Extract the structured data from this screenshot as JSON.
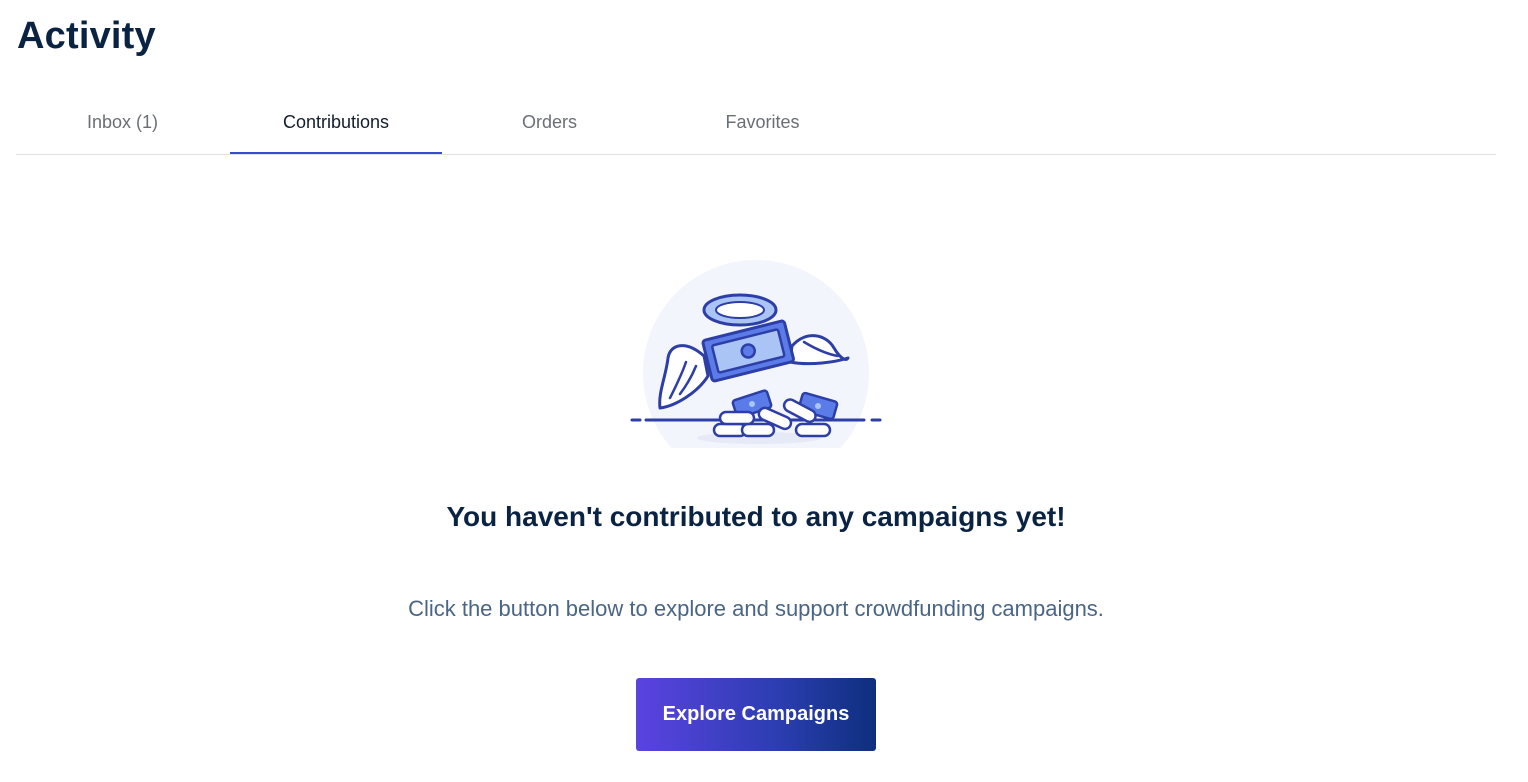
{
  "page": {
    "title": "Activity"
  },
  "tabs": [
    {
      "label": "Inbox (1)",
      "active": false
    },
    {
      "label": "Contributions",
      "active": true
    },
    {
      "label": "Orders",
      "active": false
    },
    {
      "label": "Favorites",
      "active": false
    }
  ],
  "empty_state": {
    "illustration": "angel-money-icon",
    "heading": "You haven't contributed to any campaigns yet!",
    "subtext": "Click the button below to explore and support crowdfunding campaigns.",
    "button_label": "Explore Campaigns"
  },
  "colors": {
    "title": "#0b2343",
    "active_tab_underline": "#3a4bd0",
    "illustration_stroke": "#2d3fa6",
    "illustration_fill": "#5b7ce8",
    "button_gradient_start": "#5a43e0",
    "button_gradient_end": "#0e2f7e"
  }
}
